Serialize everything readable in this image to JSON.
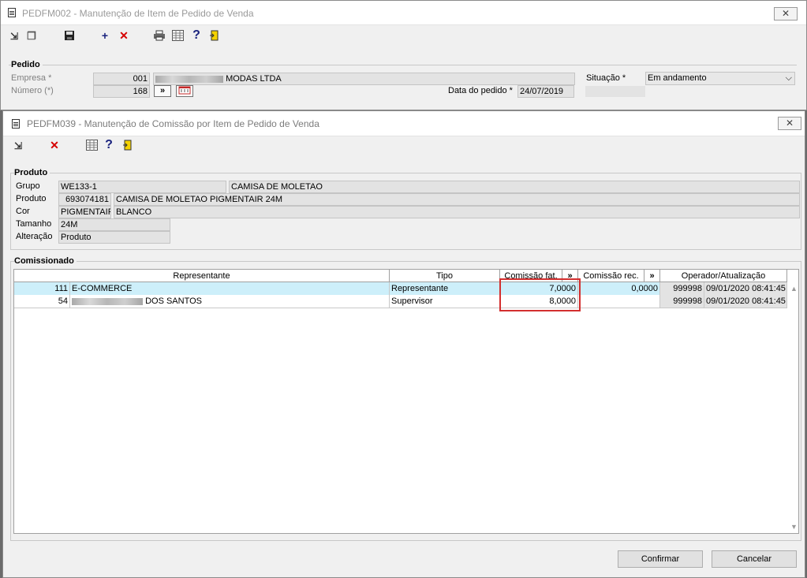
{
  "parent_window": {
    "title": "PEDFM002 - Manutenção de Item de Pedido de Venda",
    "close_label": "✕",
    "toolbar_icons": [
      "open-icon",
      "copy-icon",
      "save-icon",
      "add-icon",
      "delete-icon",
      "print-icon",
      "grid-icon",
      "help-icon",
      "exit-icon"
    ],
    "group_title": "Pedido",
    "empresa_label": "Empresa *",
    "empresa_code": "001",
    "empresa_name_suffix": "MODAS LTDA",
    "numero_label": "Número (*)",
    "numero_value": "168",
    "more_btn": "»",
    "data_label": "Data do pedido *",
    "data_value": "24/07/2019",
    "situacao_label": "Situação *",
    "situacao_value": "Em andamento"
  },
  "child_window": {
    "title": "PEDFM039 - Manutenção de Comissão por Item de Pedido de Venda",
    "close_label": "✕",
    "toolbar_icons": [
      "open-icon",
      "delete-icon",
      "grid-icon",
      "help-icon",
      "exit-icon"
    ],
    "produto": {
      "group_title": "Produto",
      "grupo_label": "Grupo",
      "grupo_code": "WE133-1",
      "grupo_desc": "CAMISA DE MOLETAO",
      "produto_label": "Produto",
      "produto_code": "693074181",
      "produto_desc": "CAMISA DE MOLETAO PIGMENTAIR 24M",
      "cor_label": "Cor",
      "cor_code": "PIGMENTAIR",
      "cor_desc": "BLANCO",
      "tamanho_label": "Tamanho",
      "tamanho_value": "24M",
      "alteracao_label": "Alteração",
      "alteracao_value": "Produto"
    },
    "comissionado": {
      "group_title": "Comissionado",
      "headers": {
        "representante": "Representante",
        "tipo": "Tipo",
        "comissao_fat": "Comissão fat.",
        "comissao_rec": "Comissão rec.",
        "operador": "Operador/Atualização",
        "more": "»"
      },
      "rows": [
        {
          "codigo": "111",
          "nome": "E-COMMERCE",
          "tipo": "Representante",
          "comissao_fat": "7,0000",
          "comissao_rec": "0,0000",
          "operador": "999998",
          "atualizacao": "09/01/2020 08:41:45"
        },
        {
          "codigo": "54",
          "nome": "DOS SANTOS",
          "tipo": "Supervisor",
          "comissao_fat": "8,0000",
          "comissao_rec": "",
          "operador": "999998",
          "atualizacao": "09/01/2020 08:41:45"
        }
      ]
    },
    "buttons": {
      "confirmar": "Confirmar",
      "cancelar": "Cancelar"
    },
    "accent_highlight_color": "#d32f2f",
    "selected_row_color": "#cdeffa"
  }
}
